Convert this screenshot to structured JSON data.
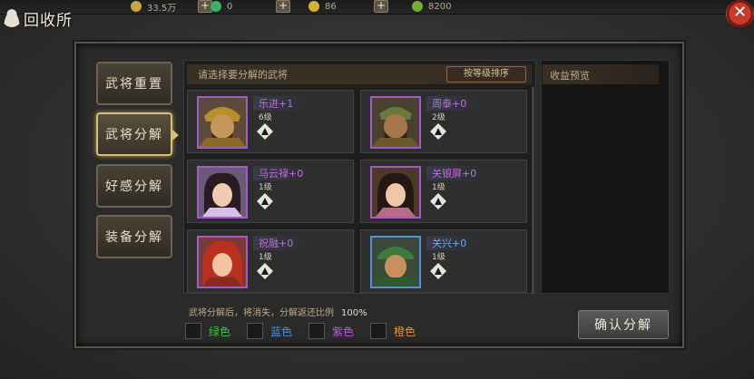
{
  "page": {
    "title": "回收所"
  },
  "resources": [
    {
      "icon": "coin-icon",
      "value": "33.5万",
      "color": "#c9a64a"
    },
    {
      "icon": "jade-icon",
      "value": "0",
      "color": "#3fae6a"
    },
    {
      "icon": "gold-ingot-icon",
      "value": "86",
      "color": "#d8b040"
    },
    {
      "icon": "green-orb-icon",
      "value": "8200",
      "color": "#6fae3a"
    }
  ],
  "sidebar": {
    "items": [
      {
        "label": "武将重置",
        "active": false
      },
      {
        "label": "武将分解",
        "active": true
      },
      {
        "label": "好感分解",
        "active": false
      },
      {
        "label": "装备分解",
        "active": false
      }
    ]
  },
  "list": {
    "header": "请选择要分解的武将",
    "sort_label": "按等级排序",
    "heroes": [
      {
        "name": "乐进+1",
        "level": "6级",
        "frame_color": "#a35cc7",
        "name_color": "#c06ce0"
      },
      {
        "name": "周泰+0",
        "level": "2级",
        "frame_color": "#a35cc7",
        "name_color": "#c06ce0"
      },
      {
        "name": "马云禄+0",
        "level": "1级",
        "frame_color": "#a35cc7",
        "name_color": "#c06ce0"
      },
      {
        "name": "关银屏+0",
        "level": "1级",
        "frame_color": "#a35cc7",
        "name_color": "#c06ce0"
      },
      {
        "name": "祝融+0",
        "level": "1级",
        "frame_color": "#a35cc7",
        "name_color": "#c06ce0"
      },
      {
        "name": "关兴+0",
        "level": "1级",
        "frame_color": "#5a8fd0",
        "name_color": "#6fa6e8"
      }
    ]
  },
  "preview": {
    "title": "收益预览"
  },
  "footer": {
    "info": "武将分解后，将消失，分解返还比例",
    "ratio": "100%",
    "filters": [
      {
        "label": "绿色",
        "color": "#3fbf4a"
      },
      {
        "label": "蓝色",
        "color": "#4a8fe0"
      },
      {
        "label": "紫色",
        "color": "#b85ad8"
      },
      {
        "label": "橙色",
        "color": "#e0923a"
      }
    ],
    "confirm_label": "确认分解"
  }
}
